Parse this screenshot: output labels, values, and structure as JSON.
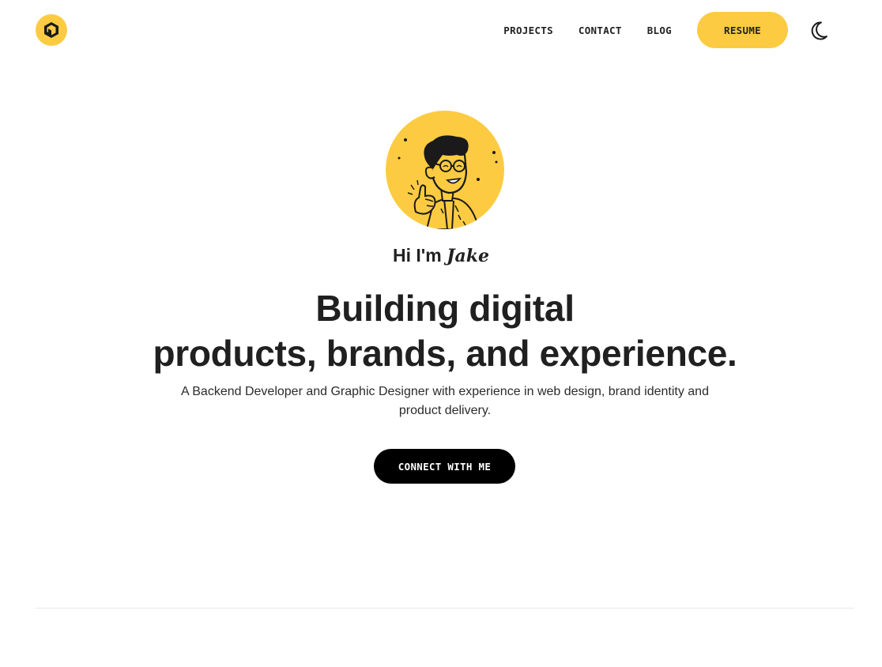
{
  "header": {
    "nav": [
      {
        "label": "PROJECTS"
      },
      {
        "label": "CONTACT"
      },
      {
        "label": "BLOG"
      }
    ],
    "resume_label": "RESUME",
    "icons": {
      "logo": "hexagon-logo-icon",
      "theme": "moon-icon"
    }
  },
  "hero": {
    "greeting_prefix": "Hi I'm ",
    "name": "Jake",
    "headline_line1": "Building digital",
    "headline_line2": "products, brands, and experience.",
    "subtitle": "A Backend Developer and Graphic Designer with experience in web design, brand identity and product delivery.",
    "cta_label": "CONNECT WITH ME",
    "avatar_icon": "cartoon-avatar-thumbs-up"
  },
  "colors": {
    "accent": "#fccb41",
    "text": "#202020",
    "cta_bg": "#000000"
  }
}
